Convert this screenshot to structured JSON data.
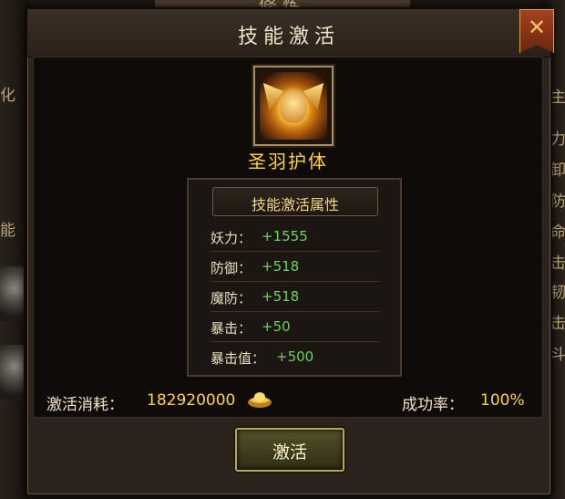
{
  "background": {
    "top_title": "修炼",
    "left_chars": [
      "化",
      "能"
    ],
    "right_chars": [
      "主",
      "力",
      "卸",
      "防",
      "命",
      "击",
      "韧",
      "击",
      "斗"
    ]
  },
  "dialog": {
    "title": "技能激活",
    "close_icon": "close-x-icon"
  },
  "skill": {
    "icon": "golden-winged-helmet-icon",
    "name": "圣羽护体"
  },
  "attributes": {
    "title": "技能激活属性",
    "rows": [
      {
        "label": "妖力：",
        "value": "+1555"
      },
      {
        "label": "防御：",
        "value": "+518"
      },
      {
        "label": "魔防：",
        "value": "+518"
      },
      {
        "label": "暴击：",
        "value": "+50"
      },
      {
        "label": "暴击值：",
        "value": "+500"
      }
    ]
  },
  "cost": {
    "label": "激活消耗：",
    "value": "182920000",
    "currency_icon": "gold-ingot-icon"
  },
  "success_rate": {
    "label": "成功率：",
    "value": "100%"
  },
  "activate_button": {
    "label": "激活"
  },
  "colors": {
    "gold_text": "#ffd43b",
    "green_value": "#6fd15c",
    "panel_bg": "#0f0b08"
  }
}
